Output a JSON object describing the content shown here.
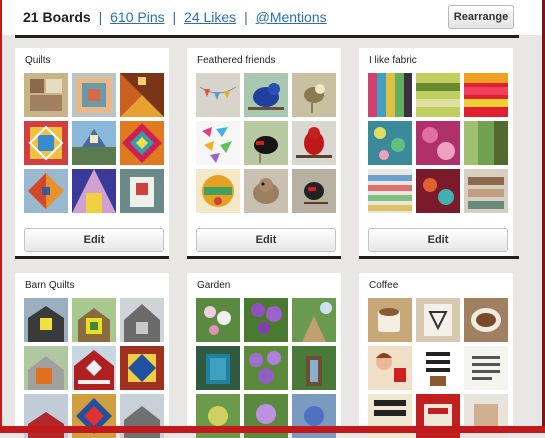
{
  "header": {
    "boards_label": "21 Boards",
    "pins_link": "610 Pins",
    "likes_link": "24 Likes",
    "mentions_link": "@Mentions",
    "separator": "|",
    "rearrange_label": "Rearrange"
  },
  "boards": [
    {
      "title": "Quilts",
      "edit_label": "Edit"
    },
    {
      "title": "Feathered friends",
      "edit_label": "Edit"
    },
    {
      "title": "I like fabric",
      "edit_label": "Edit"
    },
    {
      "title": "Barn Quilts"
    },
    {
      "title": "Garden"
    },
    {
      "title": "Coffee"
    }
  ],
  "colors": {
    "link": "#2b6fb3",
    "frame_red": "#c2191c",
    "page_background": "#e9e6e6"
  }
}
